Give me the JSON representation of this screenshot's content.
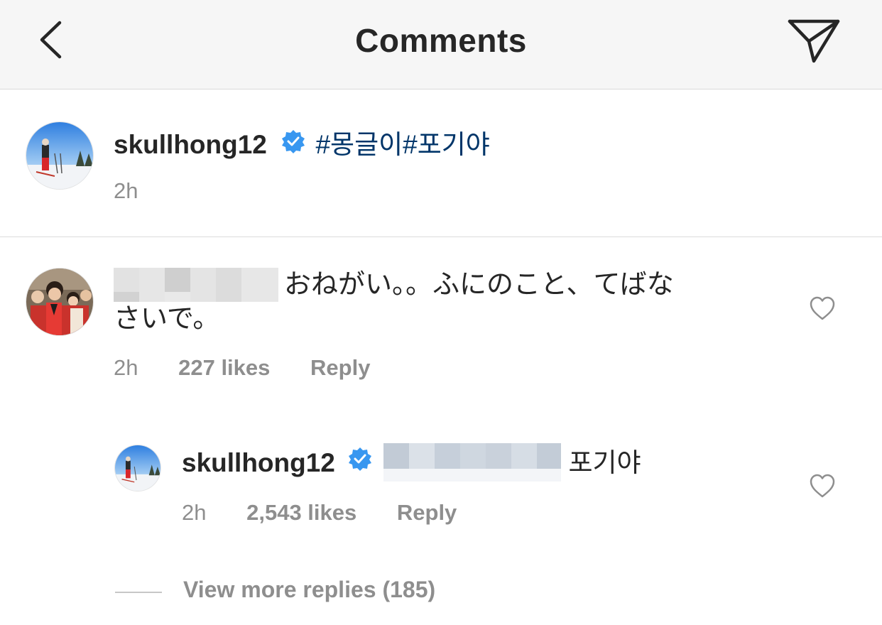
{
  "header": {
    "title": "Comments",
    "back_icon": "chevron-left-icon",
    "share_icon": "paper-plane-icon"
  },
  "caption": {
    "username": "skullhong12",
    "verified": true,
    "hashtags": "#몽글이#포기야",
    "time": "2h"
  },
  "comments": [
    {
      "username_blurred": true,
      "text_line1": "おねがい。。ふにのこと、てばな",
      "text_line2": "さいで。",
      "time": "2h",
      "likes": "227 likes",
      "reply": "Reply"
    }
  ],
  "reply": {
    "username": "skullhong12",
    "verified": true,
    "mention_blurred": true,
    "text": "포기야",
    "time": "2h",
    "likes": "2,543 likes",
    "reply": "Reply"
  },
  "view_more_replies": "View more replies (185)",
  "colors": {
    "verified_blue": "#3897f0",
    "hashtag_blue": "#003569",
    "meta_gray": "#8e8e8e",
    "header_bg": "#f6f6f6"
  }
}
